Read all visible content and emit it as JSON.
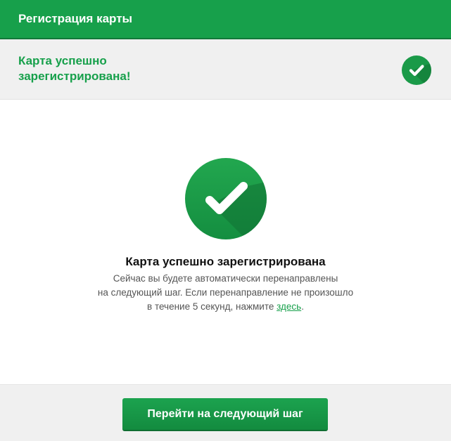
{
  "header": {
    "title": "Регистрация карты"
  },
  "status": {
    "message": "Карта успешно зарегистрирована!",
    "icon": "check-circle-icon",
    "color": "#17a04b"
  },
  "main": {
    "icon": "check-circle-icon",
    "title": "Карта успешно зарегистрирована",
    "line1": "Сейчас вы будете автоматически перенаправлены",
    "line2": "на следующий шаг. Если перенаправление не произошло",
    "line3_prefix": "в течение 5 секунд, нажмите ",
    "link_text": "здесь",
    "line3_suffix": "."
  },
  "footer": {
    "next_button_label": "Перейти на следующий шаг"
  },
  "colors": {
    "brand_green": "#17a04b",
    "background_gray": "#f0f0f0"
  }
}
